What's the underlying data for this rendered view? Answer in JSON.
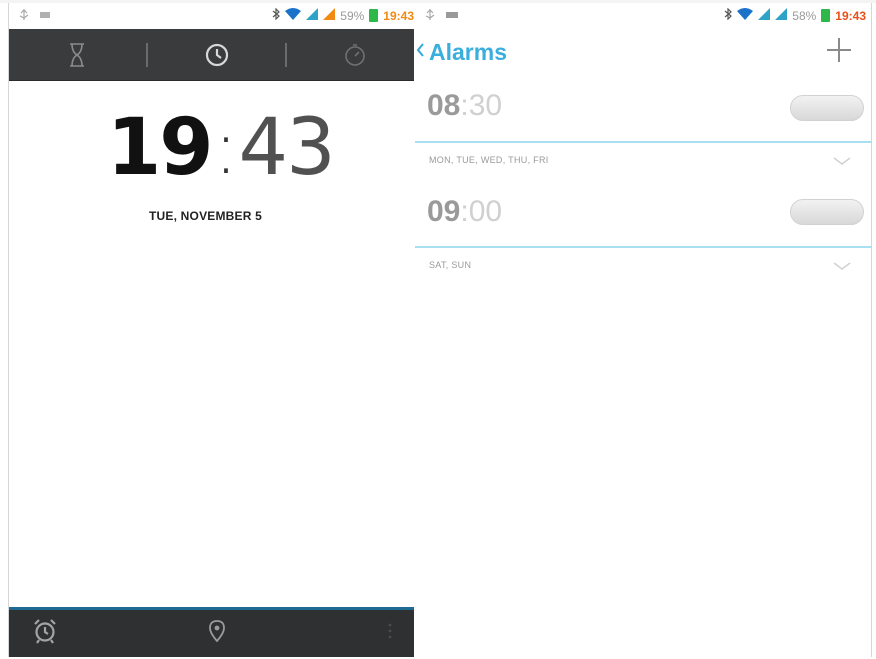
{
  "left_phone": {
    "status_bar": {
      "left_icons": [
        "usb-icon",
        "sd-card-icon"
      ],
      "battery_percent": "59%",
      "time": "19:43"
    },
    "tabs": [
      {
        "icon": "hourglass-icon",
        "label": "Timer"
      },
      {
        "icon": "clock-icon",
        "label": "Clock",
        "selected": true
      },
      {
        "icon": "stopwatch-icon",
        "label": "Stopwatch"
      }
    ],
    "clock": {
      "hour": "19",
      "separator": ":",
      "minute": "43"
    },
    "date": "TUE, NOVEMBER 5",
    "bottom_bar": {
      "icons": [
        "alarm-icon",
        "location-pin-icon",
        "overflow-menu-icon"
      ]
    },
    "colors": {
      "tabbar": "#3a3b3d",
      "bottombar": "#2f3032",
      "bottom_accent": "#1e6a92"
    }
  },
  "right_phone": {
    "status_bar": {
      "left_icons": [
        "usb-icon",
        "sd-card-icon"
      ],
      "battery_percent": "58%",
      "time": "19:43"
    },
    "header": {
      "back_icon": "chevron-left-icon",
      "title": "Alarms",
      "add_icon": "plus-icon"
    },
    "alarms": [
      {
        "hour": "08",
        "separator": ":",
        "minute": "30",
        "days": "MON, TUE, WED, THU, FRI",
        "enabled": false
      },
      {
        "hour": "09",
        "separator": ":",
        "minute": "00",
        "days": "SAT, SUN",
        "enabled": false
      }
    ],
    "colors": {
      "accent": "#3aaedc",
      "divider": "#a8dff1"
    }
  }
}
